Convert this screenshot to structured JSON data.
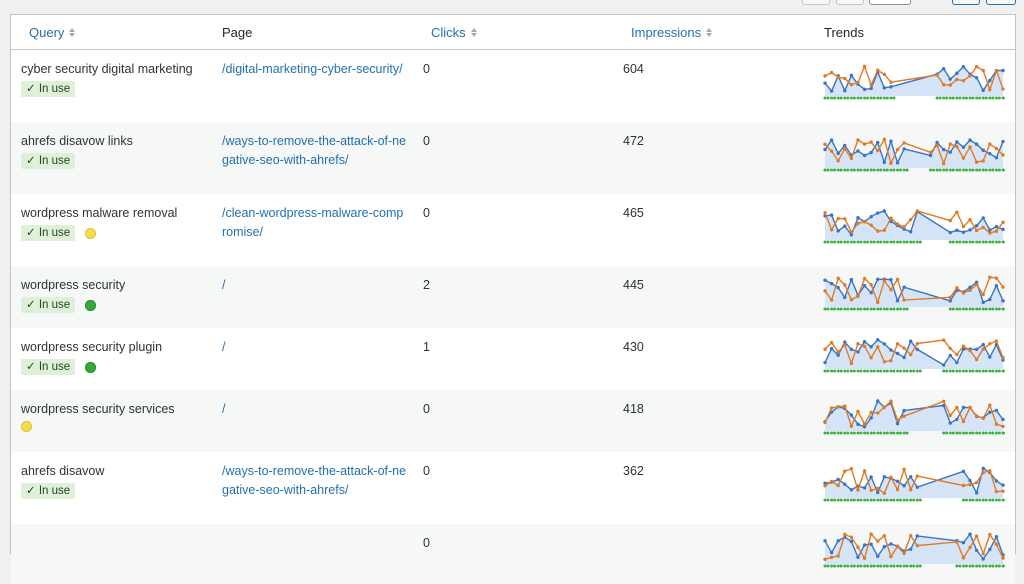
{
  "colors": {
    "link": "#2271b1",
    "impressions_line": "#e07b24",
    "clicks_line": "#3a74c4",
    "usage_dots": "#3cb043",
    "fill": "#d5e5f7",
    "badge_bg": "#dff0d8"
  },
  "columns": {
    "query": "Query",
    "page": "Page",
    "clicks": "Clicks",
    "impressions": "Impressions",
    "trends": "Trends"
  },
  "in_use_label": "✓ In use",
  "rows": [
    {
      "query": "cyber security digital marketing",
      "in_use": true,
      "dot": null,
      "page": "/digital-marketing-cyber-security/",
      "clicks": "0",
      "impressions": "604",
      "seed": 3
    },
    {
      "query": "ahrefs disavow links",
      "in_use": true,
      "dot": null,
      "page": "/ways-to-remove-the-attack-of-negative-seo-with-ahrefs/",
      "clicks": "0",
      "impressions": "472",
      "seed": 7
    },
    {
      "query": "wordpress malware removal",
      "in_use": true,
      "dot": "yellow",
      "page": "/clean-wordpress-malware-compromise/",
      "clicks": "0",
      "impressions": "465",
      "seed": 11
    },
    {
      "query": "wordpress security",
      "in_use": true,
      "dot": "green",
      "page": "/",
      "clicks": "2",
      "impressions": "445",
      "seed": 13
    },
    {
      "query": "wordpress security plugin",
      "in_use": true,
      "dot": "green",
      "page": "/",
      "clicks": "1",
      "impressions": "430",
      "seed": 17
    },
    {
      "query": "wordpress security services",
      "in_use": false,
      "dot": "yellow",
      "page": "/",
      "clicks": "0",
      "impressions": "418",
      "seed": 19
    },
    {
      "query": "ahrefs disavow",
      "in_use": true,
      "dot": null,
      "page": "/ways-to-remove-the-attack-of-negative-seo-with-ahrefs/",
      "clicks": "0",
      "impressions": "362",
      "seed": 23
    },
    {
      "query": "",
      "in_use": false,
      "dot": null,
      "page": "",
      "clicks": "0",
      "impressions": "",
      "seed": 29
    }
  ]
}
